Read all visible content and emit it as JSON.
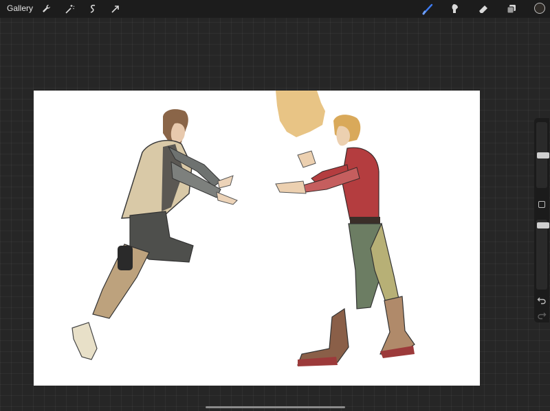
{
  "topbar": {
    "gallery_label": "Gallery",
    "left_tools": [
      "wrench-icon",
      "magic-wand-icon",
      "selection-icon",
      "transform-arrow-icon"
    ],
    "right_tools": [
      "brush-icon",
      "smudge-icon",
      "eraser-icon",
      "layers-icon"
    ],
    "active_tool": "brush-icon",
    "active_tool_color": "#3d7bf2",
    "current_color": "#2f2b27"
  },
  "canvas": {
    "background": "#ffffff",
    "content": "sketch-two-figures-reaching"
  },
  "sidebar": {
    "brush_size_level": 0.65,
    "brush_opacity_level": 0.86,
    "icons": [
      "undo-icon",
      "redo-icon"
    ]
  }
}
